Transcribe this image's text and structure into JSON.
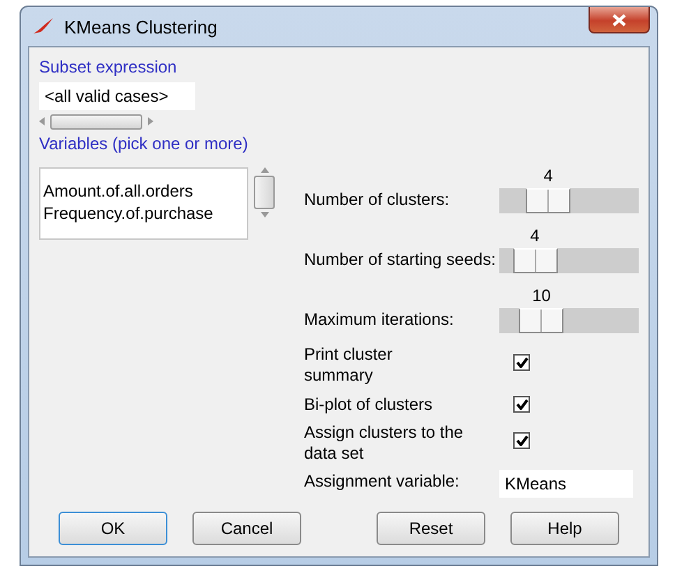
{
  "window": {
    "title": "KMeans Clustering"
  },
  "subset": {
    "label": "Subset expression",
    "value": "<all valid cases>"
  },
  "variables": {
    "label": "Variables (pick one or more)",
    "items": [
      {
        "label": "Amount.of.all.orders",
        "selected": false
      },
      {
        "label": "Frequency.of.purchase",
        "selected": false
      }
    ]
  },
  "options": [
    {
      "kind": "slider",
      "label": "Number of clusters:",
      "reading": "4",
      "level": 0.28
    },
    {
      "kind": "slider",
      "label": "Number of starting seeds:",
      "reading": "4",
      "level": 0.14
    },
    {
      "kind": "slider",
      "label": "Maximum iterations:",
      "reading": "10",
      "level": 0.21
    },
    {
      "kind": "checkbox",
      "label": "Print cluster summary",
      "checked": true
    },
    {
      "kind": "checkbox",
      "label": "Bi-plot of clusters",
      "checked": true
    },
    {
      "kind": "checkbox",
      "label": "Assign clusters to the data set",
      "checked": true
    },
    {
      "kind": "field",
      "label": "Assignment variable:",
      "value": "KMeans"
    }
  ],
  "buttons": [
    {
      "label": "OK",
      "default": true
    },
    {
      "label": "Cancel",
      "default": false
    },
    {
      "label": "Reset",
      "default": false
    },
    {
      "label": "Help",
      "default": false
    }
  ]
}
